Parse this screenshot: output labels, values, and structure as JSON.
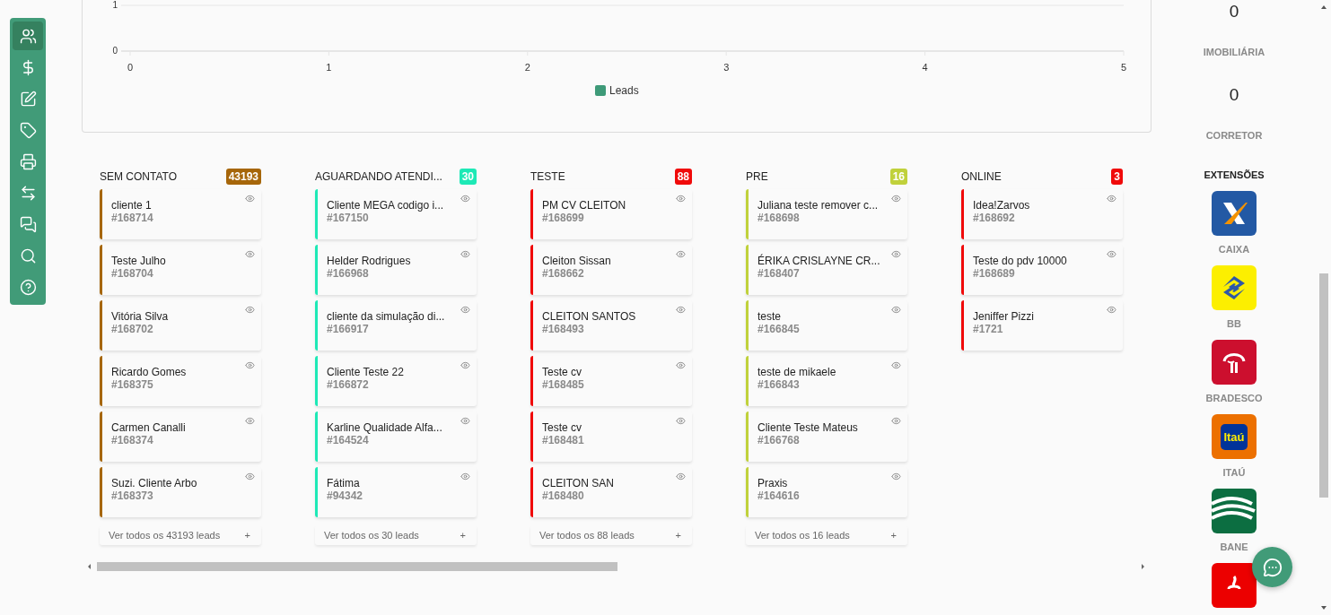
{
  "sidebar": {
    "items": [
      {
        "kind": "users",
        "selected": true
      },
      {
        "kind": "dollar",
        "selected": false
      },
      {
        "kind": "edit",
        "selected": false
      },
      {
        "kind": "tag",
        "selected": false
      },
      {
        "kind": "printer",
        "selected": false
      },
      {
        "kind": "transfer",
        "selected": false
      },
      {
        "kind": "messages",
        "selected": false
      },
      {
        "kind": "search",
        "selected": false
      },
      {
        "kind": "help",
        "selected": false
      }
    ]
  },
  "chart": {
    "chart_data": {
      "type": "bar",
      "orientation": "horizontal",
      "xlim": [
        0,
        5
      ],
      "xticks": [
        0,
        1,
        2,
        3,
        4,
        5
      ],
      "categories": [
        "1",
        "0"
      ],
      "series": [
        {
          "name": "Leads",
          "color": "#3e9a78",
          "values": [
            0,
            0
          ]
        }
      ]
    }
  },
  "kanban": {
    "columns": [
      {
        "title": "SEM CONTATO",
        "count": "43193",
        "color": "#a6660a",
        "footer": "Ver todos os 43193 leads",
        "add": "+",
        "cards": [
          {
            "name": "cliente 1",
            "id": "#168714"
          },
          {
            "name": "Teste Julho",
            "id": "#168704"
          },
          {
            "name": "Vitória Silva",
            "id": "#168702"
          },
          {
            "name": "Ricardo Gomes",
            "id": "#168375"
          },
          {
            "name": "Carmen Canalli",
            "id": "#168374"
          },
          {
            "name": "Suzi. Cliente Arbo",
            "id": "#168373"
          }
        ]
      },
      {
        "title": "AGUARDANDO ATENDI...",
        "count": "30",
        "color": "#1de9b6",
        "footer": "Ver todos os 30 leads",
        "add": "+",
        "cards": [
          {
            "name": "Cliente MEGA codigo i...",
            "id": "#167150"
          },
          {
            "name": "Helder Rodrigues",
            "id": "#166968"
          },
          {
            "name": "cliente da simulação di...",
            "id": "#166917"
          },
          {
            "name": "Cliente Teste 22",
            "id": "#166872"
          },
          {
            "name": "Karline Qualidade Alfa...",
            "id": "#164524"
          },
          {
            "name": "Fátima",
            "id": "#94342"
          }
        ]
      },
      {
        "title": "TESTE",
        "count": "88",
        "color": "#f00a0a",
        "footer": "Ver todos os 88 leads",
        "add": "+",
        "cards": [
          {
            "name": "PM CV CLEITON",
            "id": "#168699"
          },
          {
            "name": "Cleiton Sissan",
            "id": "#168662"
          },
          {
            "name": "CLEITON SANTOS",
            "id": "#168493"
          },
          {
            "name": "Teste cv",
            "id": "#168485"
          },
          {
            "name": "Teste cv",
            "id": "#168481"
          },
          {
            "name": "CLEITON SAN",
            "id": "#168480"
          }
        ]
      },
      {
        "title": "PRE",
        "count": "16",
        "color": "#c0d13b",
        "footer": "Ver todos os 16 leads",
        "add": "+",
        "cards": [
          {
            "name": "Juliana teste remover c...",
            "id": "#168698"
          },
          {
            "name": "ÉRIKA CRISLAYNE CR...",
            "id": "#168407"
          },
          {
            "name": "teste",
            "id": "#166845"
          },
          {
            "name": "teste de mikaele",
            "id": "#166843"
          },
          {
            "name": "Cliente Teste Mateus",
            "id": "#166768"
          },
          {
            "name": "Praxis",
            "id": "#164616"
          }
        ]
      },
      {
        "title": "ONLINE",
        "count": "3",
        "color": "#f00a0a",
        "cards": [
          {
            "name": "Idea!Zarvos",
            "id": "#168692"
          },
          {
            "name": "Teste do pdv 10000",
            "id": "#168689"
          },
          {
            "name": "Jeniffer Pizzi",
            "id": "#1721"
          }
        ]
      }
    ]
  },
  "right_panel": {
    "stats": [
      {
        "value": "0",
        "label": "IMOBILIÁRIA"
      },
      {
        "value": "0",
        "label": "CORRETOR"
      }
    ],
    "extensions_title": "EXTENSÕES",
    "extensions": [
      {
        "kind": "caixa",
        "label": "CAIXA"
      },
      {
        "kind": "bb",
        "label": "BB"
      },
      {
        "kind": "bradesco",
        "label": "BRADESCO"
      },
      {
        "kind": "itau",
        "label": "ITAÚ",
        "logo_text": "Itaú"
      },
      {
        "kind": "banestes",
        "label": "BANE"
      },
      {
        "kind": "santander"
      }
    ]
  }
}
